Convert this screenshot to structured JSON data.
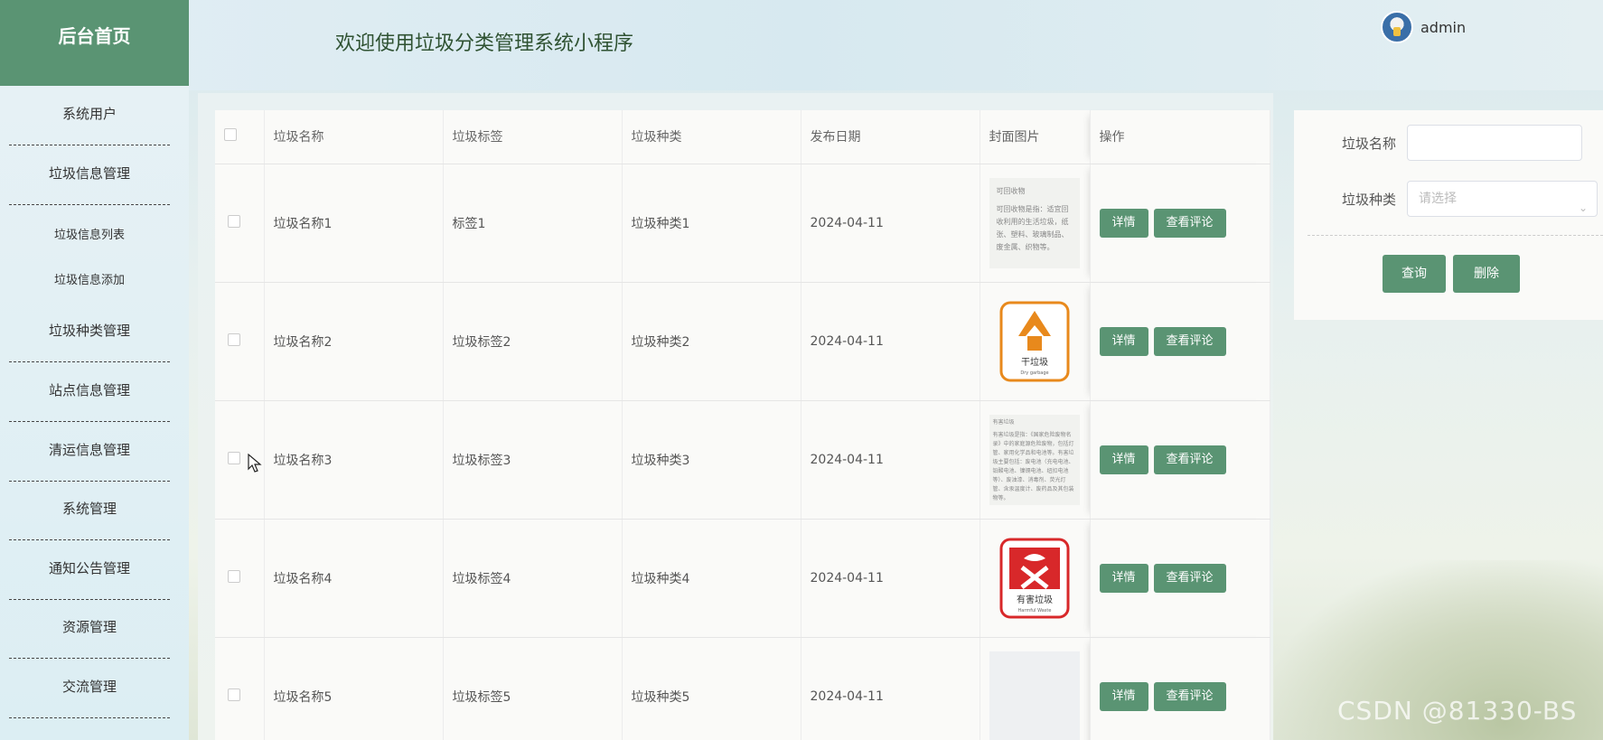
{
  "header": {
    "brand": "后台首页",
    "welcome": "欢迎使用垃圾分类管理系统小程序",
    "user": "admin"
  },
  "sidebar": {
    "items": [
      {
        "label": "系统用户"
      },
      {
        "label": "垃圾信息管理"
      },
      {
        "label": "垃圾信息列表"
      },
      {
        "label": "垃圾信息添加"
      },
      {
        "label": "垃圾种类管理"
      },
      {
        "label": "站点信息管理"
      },
      {
        "label": "清运信息管理"
      },
      {
        "label": "系统管理"
      },
      {
        "label": "通知公告管理"
      },
      {
        "label": "资源管理"
      },
      {
        "label": "交流管理"
      }
    ]
  },
  "table": {
    "columns": [
      "垃圾名称",
      "垃圾标签",
      "垃圾种类",
      "发布日期",
      "封面图片",
      "操作"
    ],
    "rows": [
      {
        "name": "垃圾名称1",
        "tag": "标签1",
        "kind": "垃圾种类1",
        "date": "2024-04-11"
      },
      {
        "name": "垃圾名称2",
        "tag": "垃圾标签2",
        "kind": "垃圾种类2",
        "date": "2024-04-11"
      },
      {
        "name": "垃圾名称3",
        "tag": "垃圾标签3",
        "kind": "垃圾种类3",
        "date": "2024-04-11"
      },
      {
        "name": "垃圾名称4",
        "tag": "垃圾标签4",
        "kind": "垃圾种类4",
        "date": "2024-04-11"
      },
      {
        "name": "垃圾名称5",
        "tag": "垃圾标签5",
        "kind": "垃圾种类5",
        "date": "2024-04-11"
      }
    ],
    "detail_label": "详情",
    "comment_label": "查看评论"
  },
  "covers": {
    "row1_title": "可回收物",
    "row1_text": "可回收物是指：适宜回收利用的生活垃圾，纸张、塑料、玻璃制品、废金属、织物等。",
    "row2_caption": "干垃圾",
    "row2_sub": "Dry garbage",
    "row3_title": "有害垃圾",
    "row3_text": "有害垃圾是指：《国家危险废物名录》中的家庭源危险废物，包括灯管、家用化学品和电池等。有害垃圾主要包括：废电池（充电电池、铅酸电池、镍镉电池、纽扣电池等）、废油漆、消毒剂、荧光灯管、含汞温度计、废药品及其包装物等。",
    "row4_caption": "有害垃圾",
    "row4_sub": "Harmful Waste"
  },
  "search": {
    "name_label": "垃圾名称",
    "kind_label": "垃圾种类",
    "kind_placeholder": "请选择",
    "query_label": "查询",
    "delete_label": "删除"
  },
  "colors": {
    "accent": "#5a9473",
    "orange": "#e8891c",
    "red": "#d8282a"
  },
  "watermark": "CSDN @81330-BS"
}
